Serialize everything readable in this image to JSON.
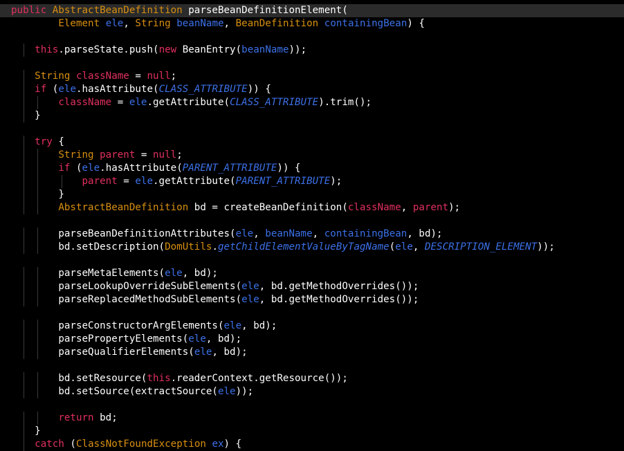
{
  "colors": {
    "background": "#000000",
    "current_line": "#2b2b2b",
    "keyword": "#e0305e",
    "type": "#d88f10",
    "identifier": "#ffffff",
    "variable": "#3c71e8",
    "constant": "#3c71e8"
  },
  "code": {
    "lines": [
      {
        "indent": 0,
        "current": true,
        "tokens": [
          [
            "public",
            "kw"
          ],
          [
            " ",
            "plain"
          ],
          [
            "AbstractBeanDefinition",
            "type"
          ],
          [
            " ",
            "plain"
          ],
          [
            "parseBeanDefinitionElement",
            "method"
          ],
          [
            "(",
            "plain"
          ]
        ]
      },
      {
        "indent": 0,
        "tokens": [
          [
            "        ",
            "plain"
          ],
          [
            "Element",
            "type"
          ],
          [
            " ",
            "plain"
          ],
          [
            "ele",
            "var"
          ],
          [
            ", ",
            "plain"
          ],
          [
            "String",
            "type"
          ],
          [
            " ",
            "plain"
          ],
          [
            "beanName",
            "var"
          ],
          [
            ", ",
            "plain"
          ],
          [
            "BeanDefinition",
            "type"
          ],
          [
            " ",
            "plain"
          ],
          [
            "containingBean",
            "var"
          ],
          [
            ") {",
            "plain"
          ]
        ]
      },
      {
        "indent": 0,
        "tokens": []
      },
      {
        "indent": 1,
        "tokens": [
          [
            "this",
            "kw"
          ],
          [
            ".parseState.push(",
            "plain"
          ],
          [
            "new",
            "kw"
          ],
          [
            " BeanEntry(",
            "plain"
          ],
          [
            "beanName",
            "var"
          ],
          [
            "));",
            "plain"
          ]
        ]
      },
      {
        "indent": 0,
        "tokens": []
      },
      {
        "indent": 1,
        "tokens": [
          [
            "String",
            "type"
          ],
          [
            " ",
            "plain"
          ],
          [
            "className",
            "field"
          ],
          [
            " = ",
            "plain"
          ],
          [
            "null",
            "kw"
          ],
          [
            ";",
            "plain"
          ]
        ]
      },
      {
        "indent": 1,
        "tokens": [
          [
            "if",
            "kw"
          ],
          [
            " (",
            "plain"
          ],
          [
            "ele",
            "var"
          ],
          [
            ".hasAttribute(",
            "plain"
          ],
          [
            "CLASS_ATTRIBUTE",
            "const"
          ],
          [
            ")) {",
            "plain"
          ]
        ]
      },
      {
        "indent": 2,
        "tokens": [
          [
            "className",
            "field"
          ],
          [
            " = ",
            "plain"
          ],
          [
            "ele",
            "var"
          ],
          [
            ".getAttribute(",
            "plain"
          ],
          [
            "CLASS_ATTRIBUTE",
            "const"
          ],
          [
            ").trim();",
            "plain"
          ]
        ]
      },
      {
        "indent": 1,
        "tokens": [
          [
            "}",
            "plain"
          ]
        ]
      },
      {
        "indent": 0,
        "tokens": []
      },
      {
        "indent": 1,
        "tokens": [
          [
            "try",
            "kw"
          ],
          [
            " {",
            "plain"
          ]
        ]
      },
      {
        "indent": 2,
        "tokens": [
          [
            "String",
            "type"
          ],
          [
            " ",
            "plain"
          ],
          [
            "parent",
            "field"
          ],
          [
            " = ",
            "plain"
          ],
          [
            "null",
            "kw"
          ],
          [
            ";",
            "plain"
          ]
        ]
      },
      {
        "indent": 2,
        "tokens": [
          [
            "if",
            "kw"
          ],
          [
            " (",
            "plain"
          ],
          [
            "ele",
            "var"
          ],
          [
            ".hasAttribute(",
            "plain"
          ],
          [
            "PARENT_ATTRIBUTE",
            "const"
          ],
          [
            ")) {",
            "plain"
          ]
        ]
      },
      {
        "indent": 3,
        "tokens": [
          [
            "parent",
            "field"
          ],
          [
            " = ",
            "plain"
          ],
          [
            "ele",
            "var"
          ],
          [
            ".getAttribute(",
            "plain"
          ],
          [
            "PARENT_ATTRIBUTE",
            "const"
          ],
          [
            ");",
            "plain"
          ]
        ]
      },
      {
        "indent": 2,
        "tokens": [
          [
            "}",
            "plain"
          ]
        ]
      },
      {
        "indent": 2,
        "tokens": [
          [
            "AbstractBeanDefinition",
            "type"
          ],
          [
            " bd = createBeanDefinition(",
            "plain"
          ],
          [
            "className",
            "field"
          ],
          [
            ", ",
            "plain"
          ],
          [
            "parent",
            "field"
          ],
          [
            ");",
            "plain"
          ]
        ]
      },
      {
        "indent": 0,
        "tokens": []
      },
      {
        "indent": 2,
        "tokens": [
          [
            "parseBeanDefinitionAttributes(",
            "plain"
          ],
          [
            "ele",
            "var"
          ],
          [
            ", ",
            "plain"
          ],
          [
            "beanName",
            "var"
          ],
          [
            ", ",
            "plain"
          ],
          [
            "containingBean",
            "var"
          ],
          [
            ", bd);",
            "plain"
          ]
        ]
      },
      {
        "indent": 2,
        "tokens": [
          [
            "bd.setDescription(",
            "plain"
          ],
          [
            "DomUtils",
            "type"
          ],
          [
            ".",
            "plain"
          ],
          [
            "getChildElementValueByTagName",
            "smethod"
          ],
          [
            "(",
            "plain"
          ],
          [
            "ele",
            "var"
          ],
          [
            ", ",
            "plain"
          ],
          [
            "DESCRIPTION_ELEMENT",
            "const"
          ],
          [
            "));",
            "plain"
          ]
        ]
      },
      {
        "indent": 0,
        "tokens": []
      },
      {
        "indent": 2,
        "tokens": [
          [
            "parseMetaElements(",
            "plain"
          ],
          [
            "ele",
            "var"
          ],
          [
            ", bd);",
            "plain"
          ]
        ]
      },
      {
        "indent": 2,
        "tokens": [
          [
            "parseLookupOverrideSubElements(",
            "plain"
          ],
          [
            "ele",
            "var"
          ],
          [
            ", bd.getMethodOverrides());",
            "plain"
          ]
        ]
      },
      {
        "indent": 2,
        "tokens": [
          [
            "parseReplacedMethodSubElements(",
            "plain"
          ],
          [
            "ele",
            "var"
          ],
          [
            ", bd.getMethodOverrides());",
            "plain"
          ]
        ]
      },
      {
        "indent": 0,
        "tokens": []
      },
      {
        "indent": 2,
        "tokens": [
          [
            "parseConstructorArgElements(",
            "plain"
          ],
          [
            "ele",
            "var"
          ],
          [
            ", bd);",
            "plain"
          ]
        ]
      },
      {
        "indent": 2,
        "tokens": [
          [
            "parsePropertyElements(",
            "plain"
          ],
          [
            "ele",
            "var"
          ],
          [
            ", bd);",
            "plain"
          ]
        ]
      },
      {
        "indent": 2,
        "tokens": [
          [
            "parseQualifierElements(",
            "plain"
          ],
          [
            "ele",
            "var"
          ],
          [
            ", bd);",
            "plain"
          ]
        ]
      },
      {
        "indent": 0,
        "tokens": []
      },
      {
        "indent": 2,
        "tokens": [
          [
            "bd.setResource(",
            "plain"
          ],
          [
            "this",
            "kw"
          ],
          [
            ".readerContext.getResource());",
            "plain"
          ]
        ]
      },
      {
        "indent": 2,
        "tokens": [
          [
            "bd.setSource(extractSource(",
            "plain"
          ],
          [
            "ele",
            "var"
          ],
          [
            "));",
            "plain"
          ]
        ]
      },
      {
        "indent": 0,
        "tokens": []
      },
      {
        "indent": 2,
        "tokens": [
          [
            "return",
            "kw"
          ],
          [
            " bd;",
            "plain"
          ]
        ]
      },
      {
        "indent": 1,
        "tokens": [
          [
            "}",
            "plain"
          ]
        ]
      },
      {
        "indent": 1,
        "tokens": [
          [
            "catch",
            "kw"
          ],
          [
            " (",
            "plain"
          ],
          [
            "ClassNotFoundException",
            "type"
          ],
          [
            " ",
            "plain"
          ],
          [
            "ex",
            "var"
          ],
          [
            ") {",
            "plain"
          ]
        ]
      }
    ]
  }
}
